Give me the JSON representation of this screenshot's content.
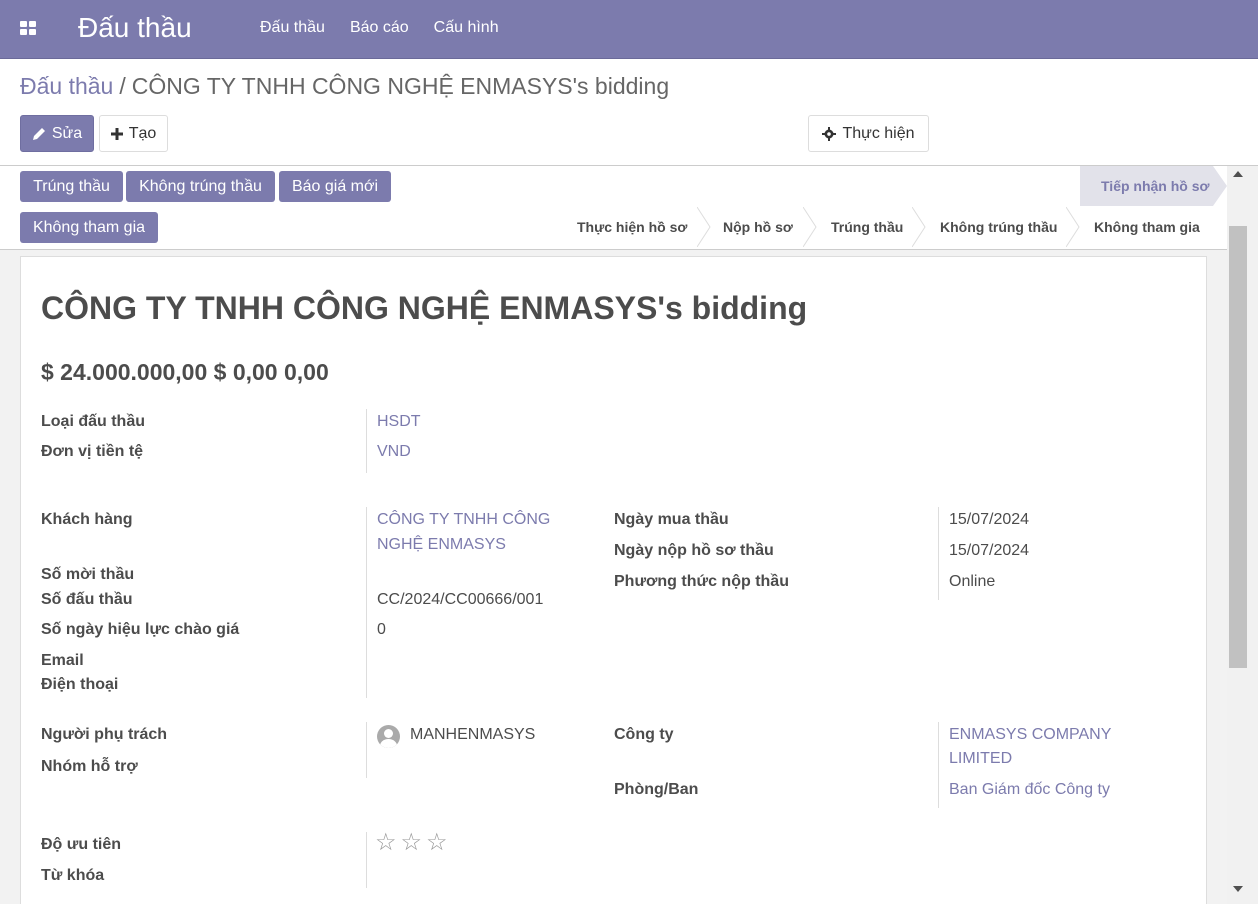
{
  "navbar": {
    "brand": "Đấu thầu",
    "menu": [
      "Đấu thầu",
      "Báo cáo",
      "Cấu hình"
    ]
  },
  "breadcrumb": {
    "parent": "Đấu thầu",
    "separator": "/",
    "current": "CÔNG TY TNHH CÔNG NGHỆ ENMASYS's bidding"
  },
  "actions": {
    "edit": "Sửa",
    "create": "Tạo",
    "action": "Thực hiện"
  },
  "status_buttons": [
    "Trúng thầu",
    "Không trúng thầu",
    "Báo giá mới",
    "Không tham gia"
  ],
  "stages": {
    "active": "Tiếp nhận hồ sơ",
    "items": [
      "Thực hiện hồ sơ",
      "Nộp hồ sơ",
      "Trúng thầu",
      "Không trúng thầu",
      "Không tham gia"
    ]
  },
  "record": {
    "title": "CÔNG TY TNHH CÔNG NGHỆ ENMASYS's bidding",
    "amount": "$ 24.000.000,00 $ 0,00 0,00",
    "fields": {
      "bid_type_label": "Loại đấu thầu",
      "bid_type_value": "HSDT",
      "currency_label": "Đơn vị tiền tệ",
      "currency_value": "VND",
      "customer_label": "Khách hàng",
      "customer_value_line1": "CÔNG TY TNHH CÔNG",
      "customer_value_line2": "NGHỆ ENMASYS",
      "invite_no_label": "Số mời thầu",
      "bid_no_label": "Số đấu thầu",
      "bid_no_value": "CC/2024/CC00666/001",
      "validity_label": "Số ngày hiệu lực chào giá",
      "validity_value": "0",
      "email_label": "Email",
      "phone_label": "Điện thoại",
      "purchase_date_label": "Ngày mua thầu",
      "purchase_date_value": "15/07/2024",
      "submit_date_label": "Ngày nộp hồ sơ thầu",
      "submit_date_value": "15/07/2024",
      "method_label": "Phương thức nộp thầu",
      "method_value": "Online",
      "responsible_label": "Người phụ trách",
      "responsible_value": "MANHENMASYS",
      "support_team_label": "Nhóm hỗ trợ",
      "company_label": "Công ty",
      "company_value_line1": "ENMASYS COMPANY",
      "company_value_line2": "LIMITED",
      "department_label": "Phòng/Ban",
      "department_value": "Ban Giám đốc Công ty",
      "priority_label": "Độ ưu tiên",
      "priority_value": 0,
      "priority_max": 3,
      "tags_label": "Từ khóa"
    }
  },
  "colors": {
    "brand": "#7c7bad",
    "text": "#4c4c4c"
  }
}
